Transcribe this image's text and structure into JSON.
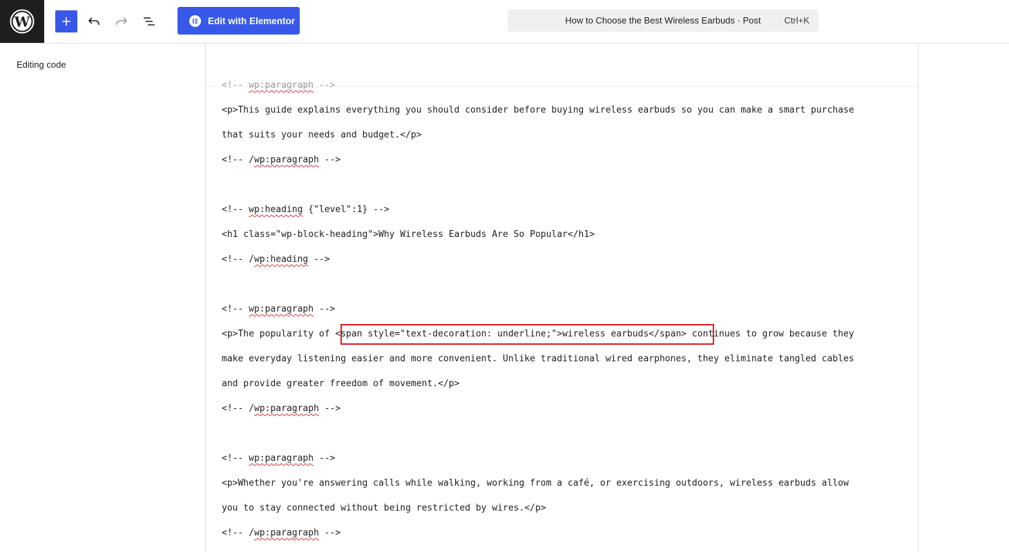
{
  "toolbar": {
    "elementor_label": "Edit with Elementor",
    "command_title": "How to Choose the Best Wireless Earbuds · Post",
    "command_shortcut": "Ctrl+K"
  },
  "sidebar": {
    "editing_label": "Editing code"
  },
  "editor": {
    "lines": [
      {
        "pre": "<!-- ",
        "sq": "wp:paragraph",
        "post": " -->"
      },
      {
        "text": "<p>This guide explains everything you should consider before buying wireless earbuds so you can make a smart purchase"
      },
      {
        "text": "that suits your needs and budget.</p>"
      },
      {
        "pre": "<!-- /",
        "sq": "wp:paragraph",
        "post": " -->"
      },
      {
        "text": ""
      },
      {
        "pre": "<!-- ",
        "sq": "wp:heading",
        "post": " {\"level\":1} -->"
      },
      {
        "text": "<h1 class=\"wp-block-heading\">Why Wireless Earbuds Are So Popular</h1>"
      },
      {
        "pre": "<!-- /",
        "sq": "wp:heading",
        "post": " -->"
      },
      {
        "text": ""
      },
      {
        "pre": "<!-- ",
        "sq": "wp:paragraph",
        "post": " -->"
      },
      {
        "text": "<p>The popularity of <span style=\"text-decoration: underline;\">wireless earbuds</span> continues to grow because they"
      },
      {
        "text": "make everyday listening easier and more convenient. Unlike traditional wired earphones, they eliminate tangled cables"
      },
      {
        "text": "and provide greater freedom of movement.</p>"
      },
      {
        "pre": "<!-- /",
        "sq": "wp:paragraph",
        "post": " -->"
      },
      {
        "text": ""
      },
      {
        "pre": "<!-- ",
        "sq": "wp:paragraph",
        "post": " -->"
      },
      {
        "text": "<p>Whether you're answering calls while walking, working from a café, or exercising outdoors, wireless earbuds allow"
      },
      {
        "text": "you to stay connected without being restricted by wires.</p>"
      },
      {
        "pre": "<!-- /",
        "sq": "wp:paragraph",
        "post": " -->"
      }
    ]
  },
  "icons": {
    "logo": "wordpress-logo-icon",
    "add": "plus-icon",
    "undo": "undo-icon",
    "redo": "redo-icon",
    "list": "document-overview-icon",
    "elementor": "elementor-icon"
  },
  "colors": {
    "accent": "#3858e9",
    "logo_bg": "#1e1e1e",
    "highlight": "#e01b1b",
    "spellcheck": "#d63638"
  }
}
